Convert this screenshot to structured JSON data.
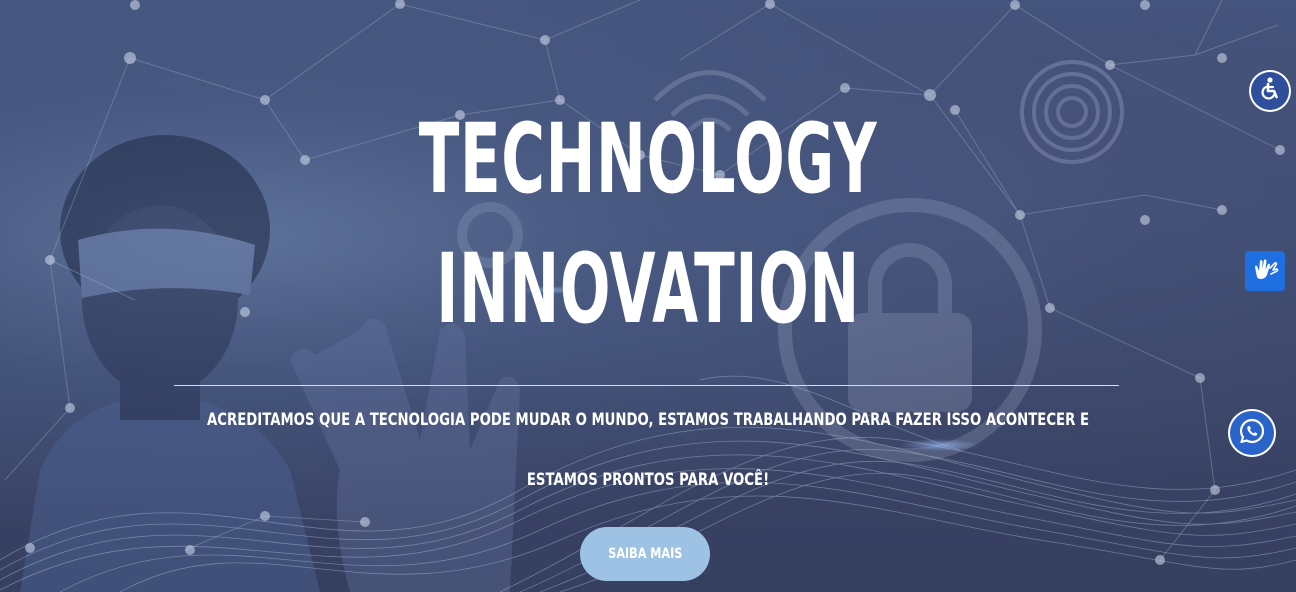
{
  "hero": {
    "headline_line1": "TECHNOLOGY",
    "headline_line2": "INNOVATION",
    "tagline_line1": "ACREDITAMOS QUE A TECNOLOGIA PODE MUDAR O MUNDO, ESTAMOS TRABALHANDO PARA FAZER ISSO ACONTECER E",
    "tagline_line2": "ESTAMOS PRONTOS PARA VOCÊ!",
    "cta_label": "SAIBA MAIS"
  },
  "floating_buttons": {
    "accessibility_icon": "wheelchair-icon",
    "sign_language_icon": "sign-language-hands-icon",
    "whatsapp_icon": "whatsapp-icon"
  },
  "colors": {
    "background": "#3b4566",
    "cta_background": "#9ec2e3",
    "accessibility_button": "#2f4e9c",
    "sign_language_button": "#1f6fe0",
    "whatsapp_button": "#2a63c9",
    "text": "#ffffff"
  }
}
